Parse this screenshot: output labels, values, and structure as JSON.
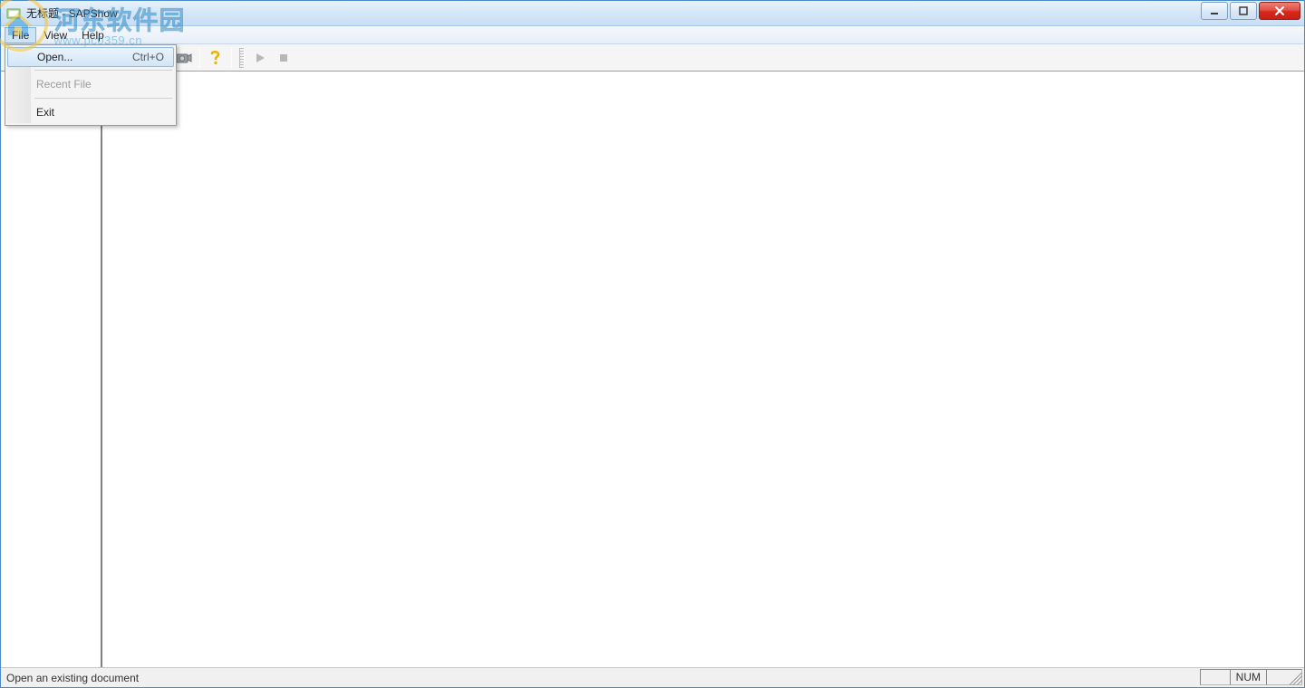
{
  "window": {
    "title": "无标题 - SAPShow"
  },
  "menubar": {
    "items": [
      {
        "label": "File"
      },
      {
        "label": "View"
      },
      {
        "label": "Help"
      }
    ]
  },
  "file_menu": {
    "open_label": "Open...",
    "open_shortcut": "Ctrl+O",
    "recent_label": "Recent File",
    "exit_label": "Exit"
  },
  "toolbar_icons": {
    "camera": "camera-icon",
    "help": "help-icon",
    "play": "play-icon",
    "stop": "stop-icon"
  },
  "statusbar": {
    "message": "Open an existing document",
    "num_label": "NUM"
  },
  "watermark": {
    "site_name_cn": "河东软件园",
    "site_url": "www.pc0359.cn"
  }
}
